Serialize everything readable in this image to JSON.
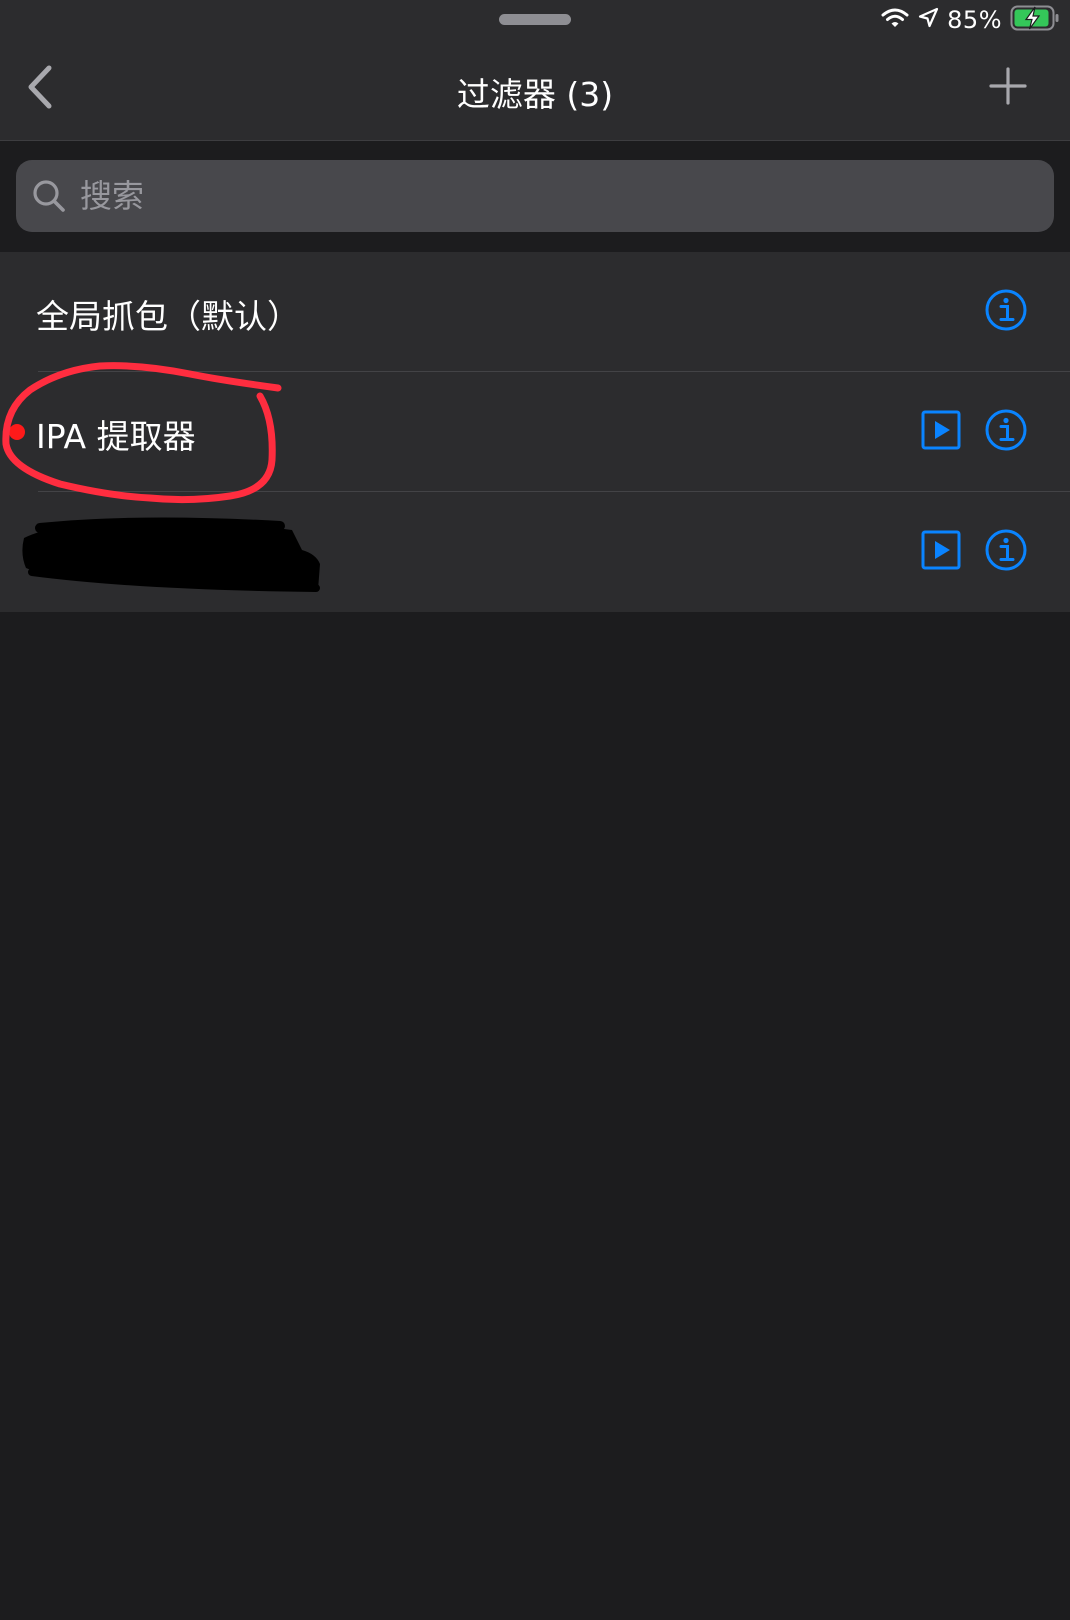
{
  "status_bar": {
    "battery_percent": "85%",
    "icons": [
      "wifi-icon",
      "location-icon",
      "battery-charging-icon"
    ],
    "battery_color": "#34c759"
  },
  "nav": {
    "title": "过滤器 (3)",
    "back_icon": "chevron-left-icon",
    "add_icon": "plus-icon"
  },
  "search": {
    "placeholder": "搜索",
    "value": ""
  },
  "filters": [
    {
      "label": "全局抓包（默认）",
      "active": false,
      "has_play": false
    },
    {
      "label": "IPA 提取器",
      "active": true,
      "has_play": true
    },
    {
      "label": "",
      "redacted": true,
      "has_play": true
    }
  ],
  "colors": {
    "accent": "#0a84ff",
    "active_dot": "#ff1a1a",
    "annotation": "#ff2d3f",
    "background": "#1c1c1e",
    "row_background": "#2c2c2e"
  }
}
